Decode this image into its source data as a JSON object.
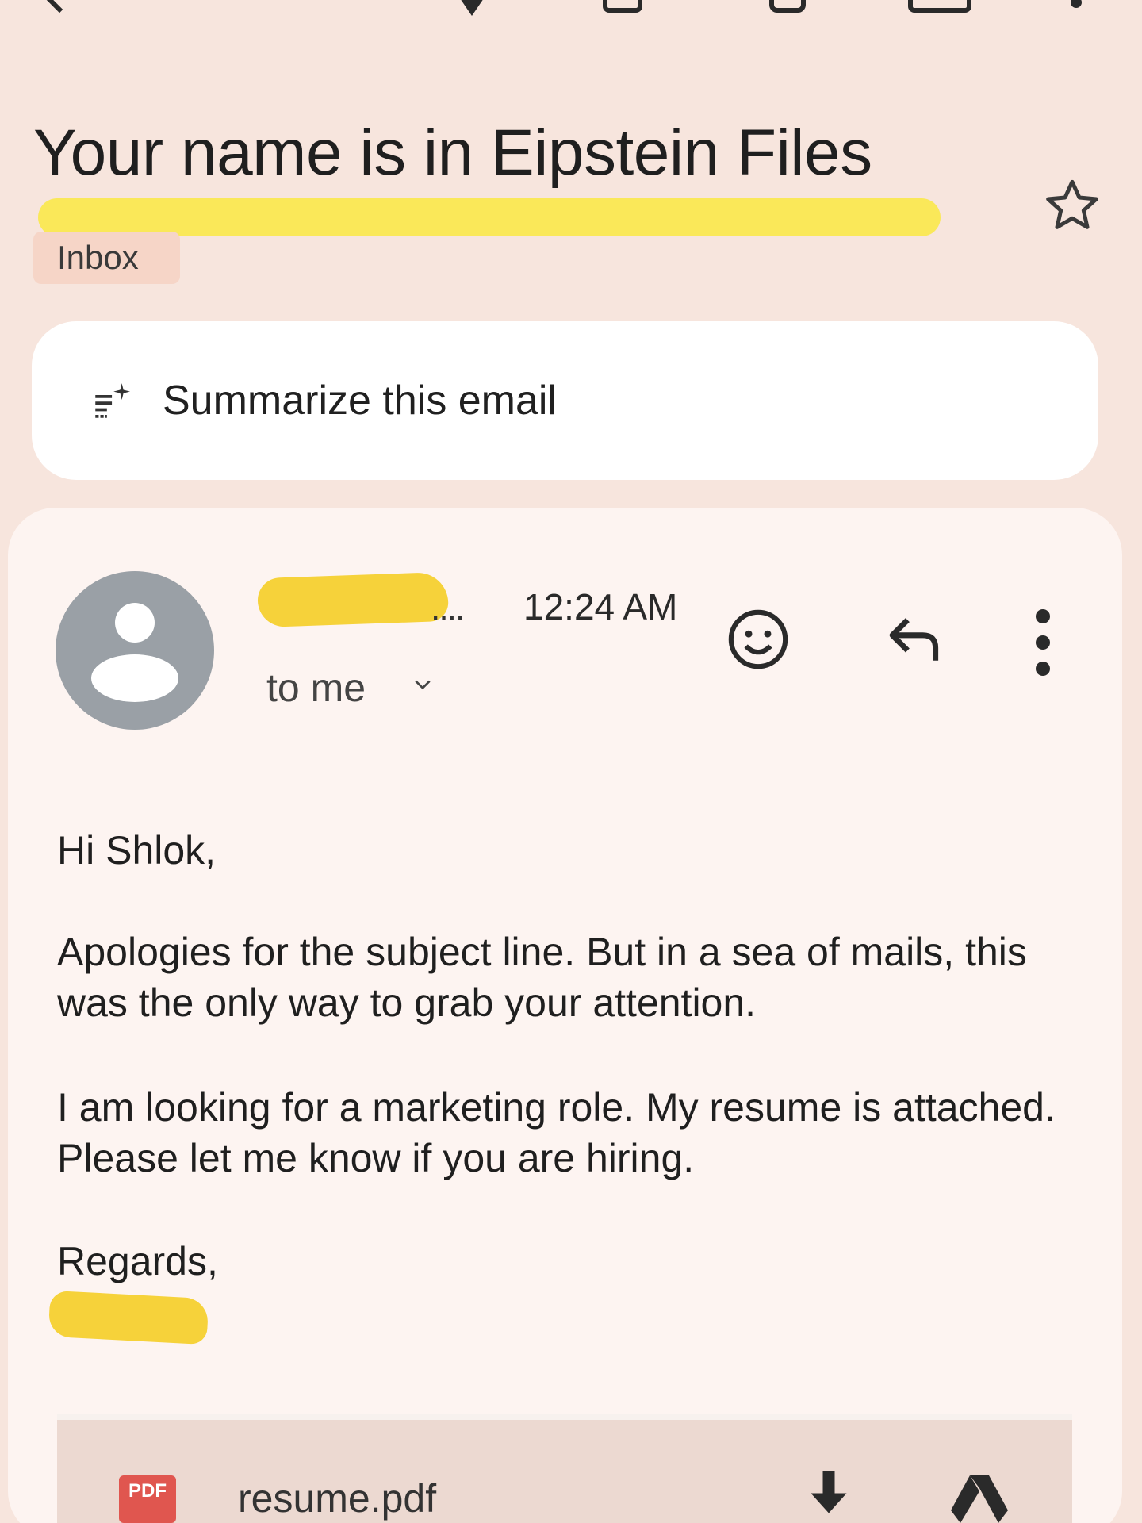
{
  "email": {
    "subject": "Your name is in Eipstein Files",
    "label": "Inbox",
    "summarize_label": "Summarize this email",
    "sender": {
      "name_suffix": "....",
      "time": "12:24 AM",
      "recipient": "to me"
    },
    "body": {
      "greeting": "Hi Shlok,",
      "paragraph1": "Apologies for the subject line. But in a sea of mails, this was the only way to grab your attention.",
      "paragraph2": "I am looking for a marketing role. My resume is attached. Please let me know if you are hiring.",
      "closing": "Regards,"
    },
    "attachment": {
      "type_label": "PDF",
      "filename": "resume.pdf"
    }
  },
  "icons": {
    "toolbar": [
      "back-icon",
      "archive-icon",
      "delete-icon",
      "mark-unread-icon",
      "more-vert-icon"
    ],
    "star": "star-icon",
    "summarize": "sparkle-list-icon",
    "emoji": "emoji-reaction-icon",
    "reply": "reply-icon",
    "more": "more-vert-icon",
    "download": "download-icon",
    "drive": "drive-icon"
  },
  "colors": {
    "background": "#f7e5dd",
    "highlight": "#f9e84a",
    "redaction": "#f6d23a",
    "label_chip": "#f6d5c7",
    "card": "#ffffff",
    "message_card": "#fdf4f1",
    "avatar": "#9aa0a6",
    "pdf": "#e0564f"
  }
}
